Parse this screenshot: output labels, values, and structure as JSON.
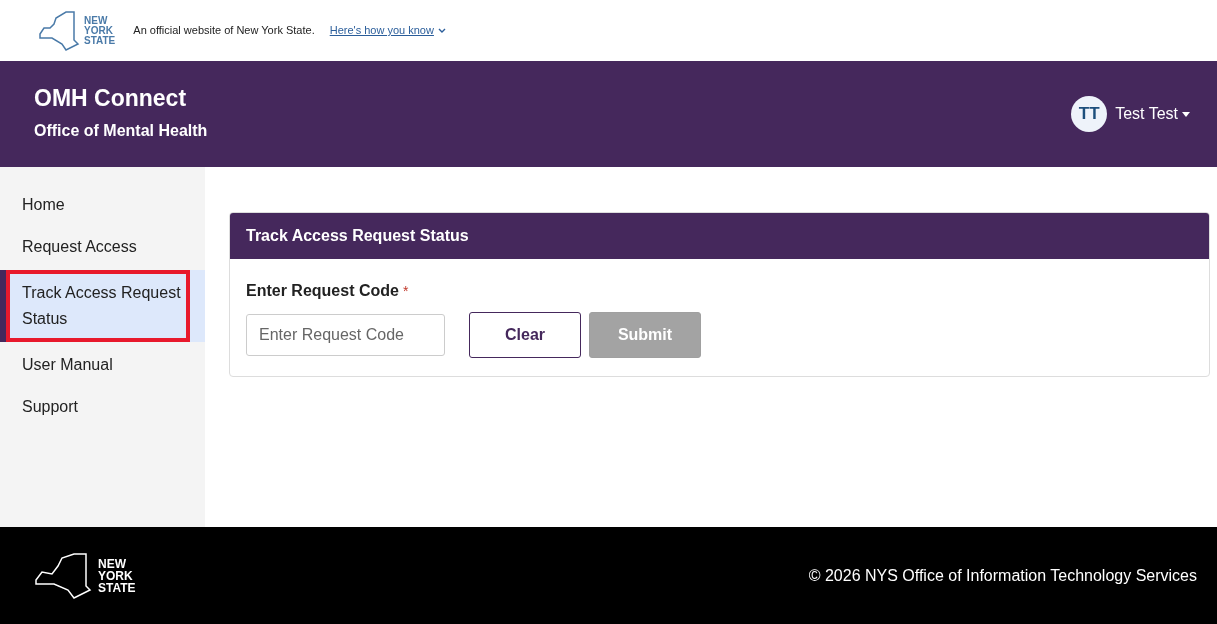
{
  "state_bar": {
    "logo_lines": [
      "NEW",
      "YORK",
      "STATE"
    ],
    "notice": "An official website of New York State.",
    "link": "Here's how you know"
  },
  "header": {
    "title": "OMH Connect",
    "subtitle": "Office of Mental Health",
    "user": {
      "initials": "TT",
      "name": "Test Test"
    }
  },
  "sidebar": {
    "items": [
      {
        "label": "Home",
        "selected": false,
        "outlined": false
      },
      {
        "label": "Request Access",
        "selected": false,
        "outlined": false
      },
      {
        "label": "Track Access Request Status",
        "selected": true,
        "outlined": true
      },
      {
        "label": "User Manual",
        "selected": false,
        "outlined": false
      },
      {
        "label": "Support",
        "selected": false,
        "outlined": false
      }
    ]
  },
  "card": {
    "title": "Track Access Request Status",
    "field_label": "Enter Request Code",
    "required_mark": "*",
    "placeholder": "Enter Request Code",
    "buttons": [
      {
        "label": "Clear",
        "disabled": false
      },
      {
        "label": "Submit",
        "disabled": true
      }
    ]
  },
  "footer": {
    "logo_lines": [
      "NEW",
      "YORK",
      "STATE"
    ],
    "copyright": "© 2026 NYS Office of Information Technology Services"
  }
}
